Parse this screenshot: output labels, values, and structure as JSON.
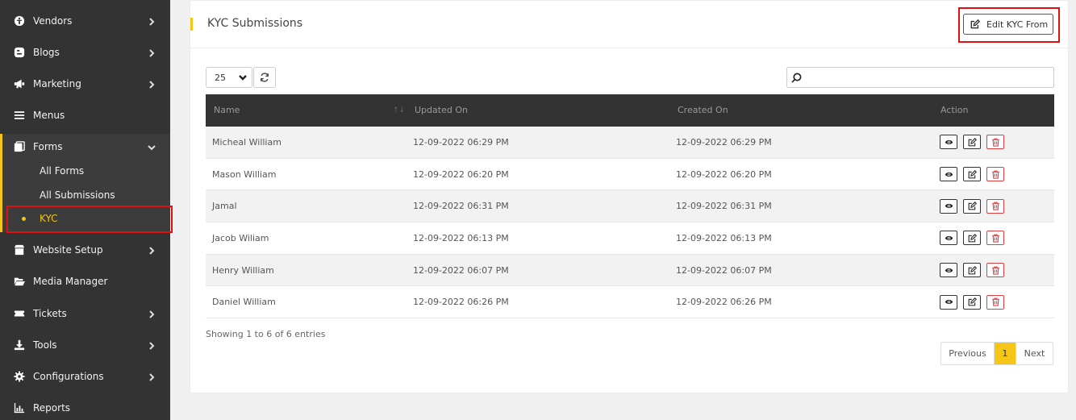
{
  "sidebar": {
    "items": [
      {
        "label": "Vendors",
        "icon": "vendors-icon",
        "has_chevron": true
      },
      {
        "label": "Blogs",
        "icon": "blogger-icon",
        "has_chevron": true
      },
      {
        "label": "Marketing",
        "icon": "megaphone-icon",
        "has_chevron": true
      },
      {
        "label": "Menus",
        "icon": "bars-icon",
        "has_chevron": false
      },
      {
        "label": "Forms",
        "icon": "forms-icon",
        "has_chevron": true,
        "expanded": true
      },
      {
        "label": "Website Setup",
        "icon": "store-icon",
        "has_chevron": true
      },
      {
        "label": "Media Manager",
        "icon": "folder-open-icon",
        "has_chevron": false
      },
      {
        "label": "Tickets",
        "icon": "ticket-icon",
        "has_chevron": true
      },
      {
        "label": "Tools",
        "icon": "download-icon",
        "has_chevron": true
      },
      {
        "label": "Configurations",
        "icon": "gear-icon",
        "has_chevron": true
      },
      {
        "label": "Reports",
        "icon": "bar-chart-icon",
        "has_chevron": false
      }
    ],
    "forms_sub": [
      {
        "label": "All Forms"
      },
      {
        "label": "All Submissions"
      },
      {
        "label": "KYC",
        "active": true
      }
    ]
  },
  "card": {
    "title": "KYC Submissions",
    "edit_button_label": "Edit KYC From"
  },
  "controls": {
    "page_length": "25",
    "search_value": ""
  },
  "table": {
    "headers": [
      "Name",
      "Updated On",
      "Created On",
      "Action"
    ],
    "rows": [
      {
        "name": "Micheal William",
        "updated": "12-09-2022 06:29 PM",
        "created": "12-09-2022 06:29 PM"
      },
      {
        "name": "Mason William",
        "updated": "12-09-2022 06:20 PM",
        "created": "12-09-2022 06:20 PM"
      },
      {
        "name": "Jamal",
        "updated": "12-09-2022 06:31 PM",
        "created": "12-09-2022 06:31 PM"
      },
      {
        "name": "Jacob Wiliam",
        "updated": "12-09-2022 06:13 PM",
        "created": "12-09-2022 06:13 PM"
      },
      {
        "name": "Henry William",
        "updated": "12-09-2022 06:07 PM",
        "created": "12-09-2022 06:07 PM"
      },
      {
        "name": "Daniel William",
        "updated": "12-09-2022 06:26 PM",
        "created": "12-09-2022 06:26 PM"
      }
    ]
  },
  "footer": {
    "info": "Showing 1 to 6 of 6 entries",
    "prev_label": "Previous",
    "page": "1",
    "next_label": "Next"
  },
  "colors": {
    "accent": "#f5c518",
    "sidebar_bg": "#333333",
    "highlight": "#e01010",
    "delete": "#e04040"
  }
}
